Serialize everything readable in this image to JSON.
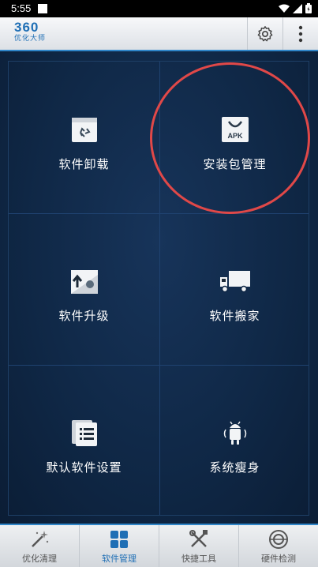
{
  "status_bar": {
    "time": "5:55"
  },
  "header": {
    "logo_number": "360",
    "logo_subtitle": "优化大师"
  },
  "tiles": [
    {
      "label": "软件卸载",
      "icon": "recycle-bin-icon"
    },
    {
      "label": "安装包管理",
      "icon": "apk-package-icon",
      "badge": "APK"
    },
    {
      "label": "软件升级",
      "icon": "upgrade-icon"
    },
    {
      "label": "软件搬家",
      "icon": "moving-truck-icon"
    },
    {
      "label": "默认软件设置",
      "icon": "document-list-icon"
    },
    {
      "label": "系统瘦身",
      "icon": "android-slim-icon"
    }
  ],
  "tabs": [
    {
      "label": "优化清理",
      "icon": "magic-wand-icon",
      "active": false
    },
    {
      "label": "软件管理",
      "icon": "app-grid-icon",
      "active": true
    },
    {
      "label": "快捷工具",
      "icon": "tools-icon",
      "active": false
    },
    {
      "label": "硬件检测",
      "icon": "hardware-check-icon",
      "active": false
    }
  ],
  "colors": {
    "accent": "#2f86c9",
    "highlight_circle": "#e04848",
    "background": "#0f2745"
  }
}
